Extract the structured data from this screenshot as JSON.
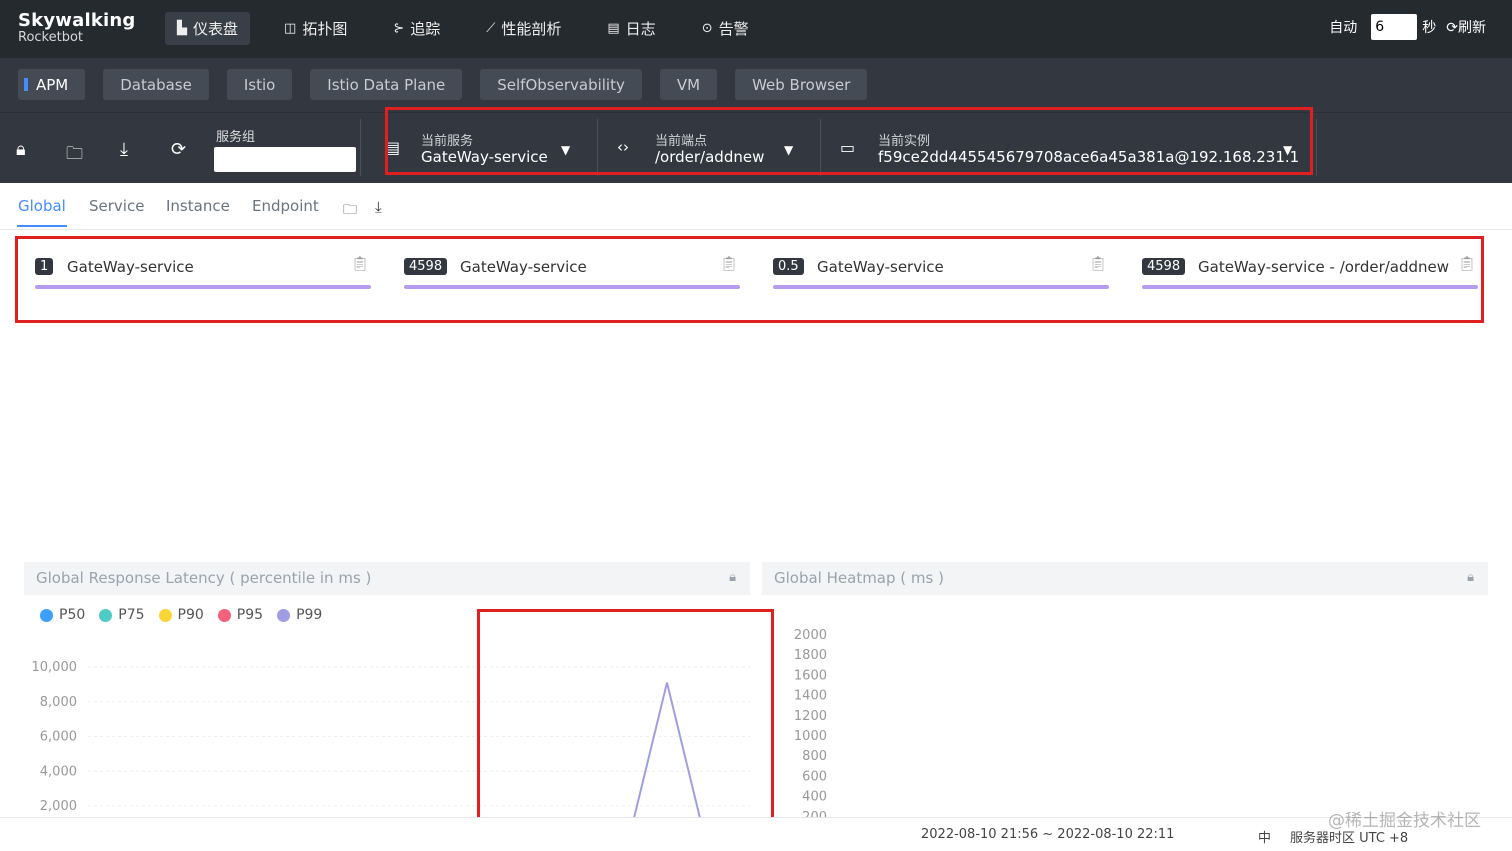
{
  "app": {
    "brand": "Skywalking",
    "sub": "Rocketbot"
  },
  "nav": [
    {
      "icon": "chart-icon",
      "glyph": "▙",
      "label": "仪表盘"
    },
    {
      "icon": "topology-icon",
      "glyph": "◫",
      "label": "拓扑图"
    },
    {
      "icon": "trace-icon",
      "glyph": "⊱",
      "label": "追踪"
    },
    {
      "icon": "profile-icon",
      "glyph": "⟋",
      "label": "性能剖析"
    },
    {
      "icon": "log-icon",
      "glyph": "▤",
      "label": "日志"
    },
    {
      "icon": "alarm-icon",
      "glyph": "⊙",
      "label": "告警"
    }
  ],
  "auto_refresh": {
    "label": "自动",
    "value": "6",
    "unit": "秒",
    "refresh": "刷新"
  },
  "layers": [
    "APM",
    "Database",
    "Istio",
    "Istio Data Plane",
    "SelfObservability",
    "VM",
    "Web Browser"
  ],
  "toolbar": {
    "group_label": "服务组"
  },
  "selectors": {
    "service": {
      "label": "当前服务",
      "value": "GateWay-service"
    },
    "endpoint": {
      "label": "当前端点",
      "value": "/order/addnew"
    },
    "instance": {
      "label": "当前实例",
      "value": "f59ce2dd445545679708ace6a45a381a@192.168.231.1"
    }
  },
  "tabs": [
    "Global",
    "Service",
    "Instance",
    "Endpoint"
  ],
  "cards": [
    {
      "badge": "1",
      "name": "GateWay-service"
    },
    {
      "badge": "4598",
      "name": "GateWay-service"
    },
    {
      "badge": "0.5",
      "name": "GateWay-service"
    },
    {
      "badge": "4598",
      "name": "GateWay-service - /order/addnew"
    }
  ],
  "panels": {
    "latency": "Global Response Latency ( percentile in ms )",
    "heatmap": "Global Heatmap ( ms )"
  },
  "chart_data": [
    {
      "type": "line",
      "title": "Global Response Latency ( percentile in ms )",
      "legend": [
        "P50",
        "P75",
        "P90",
        "P95",
        "P99"
      ],
      "legend_colors": [
        "#3aa1ff",
        "#4ecbc4",
        "#fbd437",
        "#f2637b",
        "#a09ee3"
      ],
      "yticks": [
        "10,000",
        "8,000",
        "6,000",
        "4,000",
        "2,000"
      ],
      "ytick_values": [
        10000,
        8000,
        6000,
        4000,
        2000
      ],
      "ylim": [
        2000,
        10000
      ],
      "series": [
        {
          "name": "P99",
          "values": [
            0,
            9100,
            0
          ]
        }
      ],
      "grid": true
    },
    {
      "type": "heatmap",
      "title": "Global Heatmap ( ms )",
      "yticks": [
        "2000",
        "1800",
        "1600",
        "1400",
        "1200",
        "1000",
        "800",
        "600",
        "400",
        "200"
      ],
      "ytick_values": [
        2000,
        1800,
        1600,
        1400,
        1200,
        1000,
        800,
        600,
        400,
        200
      ]
    }
  ],
  "footer": {
    "range": "2022-08-10 21:56 ~ 2022-08-10 22:11",
    "lang": "中",
    "tz": "服务器时区 UTC +8"
  },
  "watermark": "@稀土掘金技术社区"
}
